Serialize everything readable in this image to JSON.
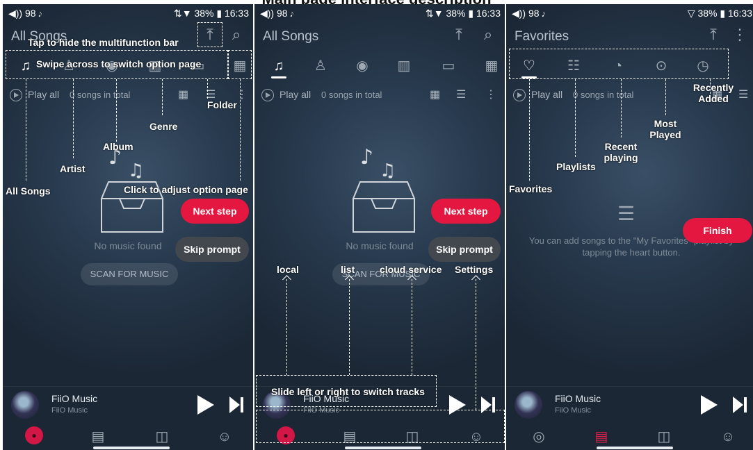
{
  "page_title": "Main page interface description",
  "status_bar": {
    "left": "◀)) 98  𝆕",
    "right_p1": "⇅▼ 38% ▮ 16:33",
    "right_p3": "▽ 38% ▮ 16:33"
  },
  "panels": {
    "p1": {
      "title": "All Songs"
    },
    "p2": {
      "title": "All Songs"
    },
    "p3": {
      "title": "Favorites"
    }
  },
  "sub_bar": {
    "play_all": "Play all",
    "count": "0 songs in total"
  },
  "empty": {
    "no_music": "No music found",
    "scan_button": "SCAN FOR MUSIC",
    "fav_hint": "You can add songs to the \"My Favorites\" playlist by tapping the heart button."
  },
  "player": {
    "title": "FiiO Music",
    "artist": "FiiO Music"
  },
  "guide": {
    "next_step": "Next step",
    "skip_prompt": "Skip prompt",
    "finish": "Finish"
  },
  "annotations": {
    "hide_bar": "Tap to hide the multifunction bar",
    "swipe": "Swipe across to switch option page",
    "folder": "Folder",
    "genre": "Genre",
    "album": "Album",
    "artist": "Artist",
    "all_songs": "All Songs",
    "adjust": "Click to adjust option page",
    "local": "local",
    "list": "list",
    "cloud": "cloud service",
    "settings": "Settings",
    "slide": "Slide left or right to switch tracks",
    "favorites": "Favorites",
    "playlists": "Playlists",
    "recent": "Recent playing",
    "most": "Most Played",
    "recently_added": "Recently Added"
  },
  "icons": {
    "tabs_songs": [
      "music-note-icon",
      "artist-icon",
      "album-icon",
      "genre-icon",
      "folder-icon",
      "grid-icon"
    ],
    "tabs_fav": [
      "heart-icon",
      "playlist-icon",
      "recent-icon",
      "most-played-icon",
      "recently-added-icon"
    ],
    "bottom_nav": [
      "local-icon",
      "list-icon",
      "cloud-icon",
      "settings-icon"
    ]
  },
  "colors": {
    "accent": "#e3173f",
    "panel_bg": "#243446"
  }
}
